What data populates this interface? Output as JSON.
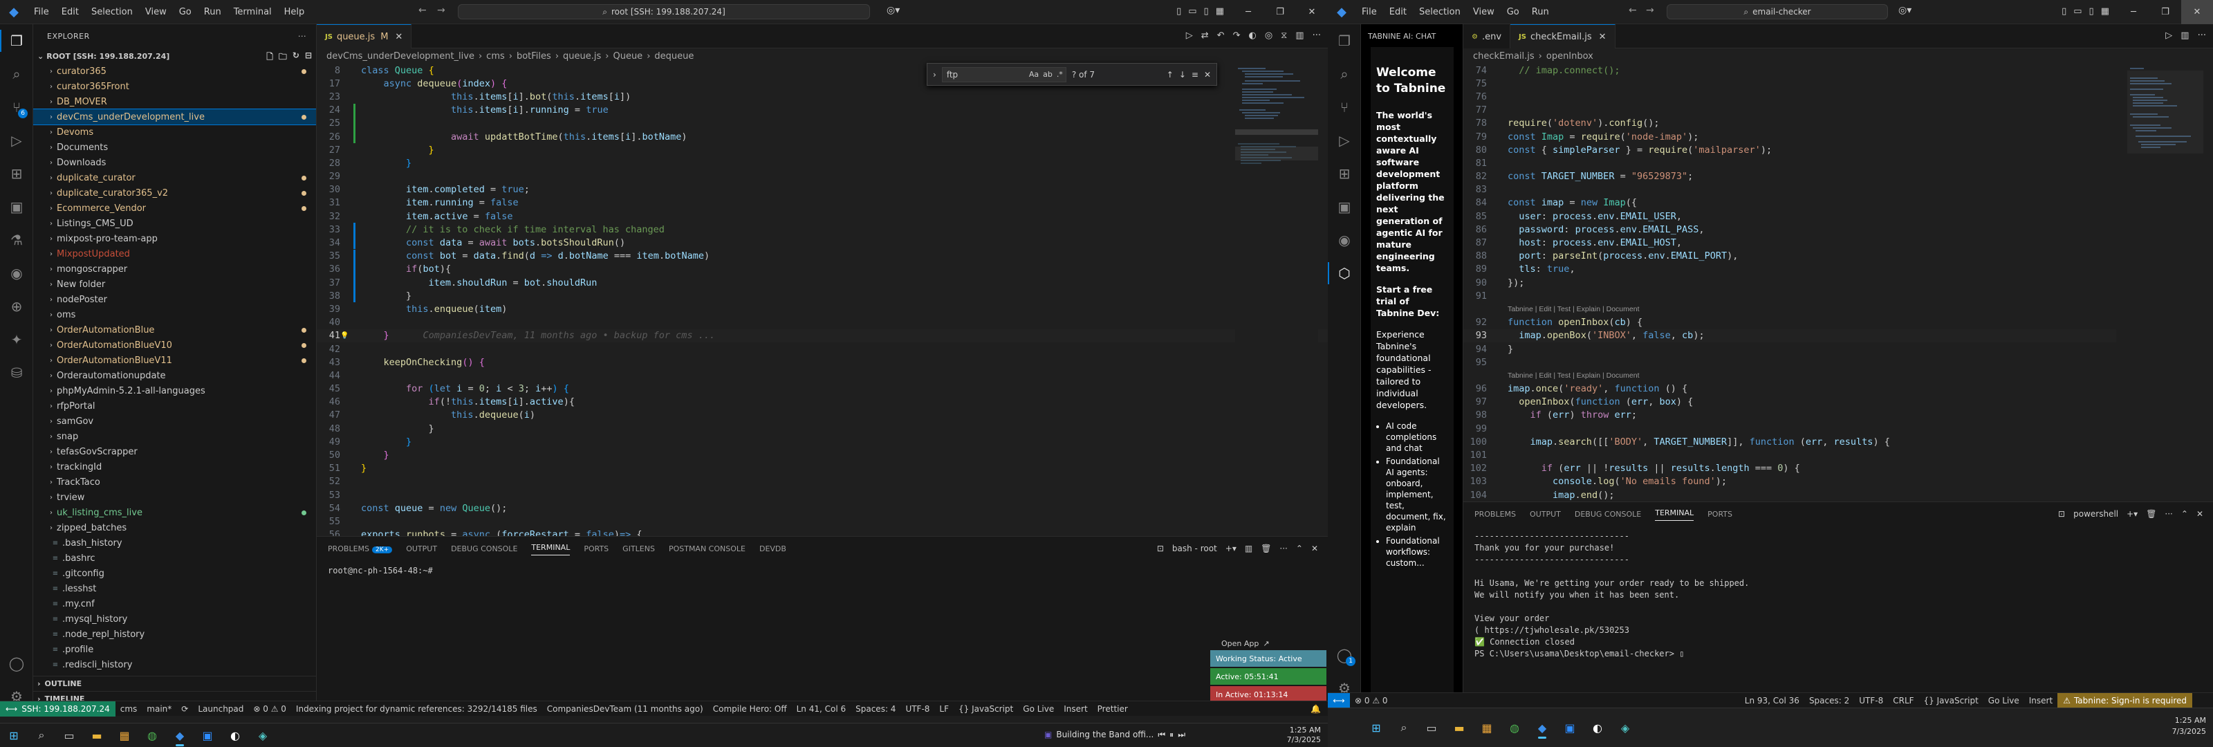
{
  "left": {
    "menu": [
      "File",
      "Edit",
      "Selection",
      "View",
      "Go",
      "Run",
      "Terminal",
      "Help"
    ],
    "command_center": "root [SSH: 199.188.207.24]",
    "explorer": {
      "title": "EXPLORER",
      "root": "ROOT [SSH: 199.188.207.24]",
      "items": [
        {
          "label": "curator365",
          "kind": "folder",
          "status": "mod",
          "dot": "#e2c08d"
        },
        {
          "label": "curator365Front",
          "kind": "folder",
          "status": "mod"
        },
        {
          "label": "DB_MOVER",
          "kind": "folder",
          "status": "mod"
        },
        {
          "label": "devCms_underDevelopment_live",
          "kind": "folder",
          "status": "mod",
          "selected": true,
          "dot": "#e2c08d"
        },
        {
          "label": "Devoms",
          "kind": "folder",
          "status": "mod"
        },
        {
          "label": "Documents",
          "kind": "folder",
          "status": "def"
        },
        {
          "label": "Downloads",
          "kind": "folder",
          "status": "def"
        },
        {
          "label": "duplicate_curator",
          "kind": "folder",
          "status": "mod",
          "dot": "#e2c08d"
        },
        {
          "label": "duplicate_curator365_v2",
          "kind": "folder",
          "status": "mod",
          "dot": "#e2c08d"
        },
        {
          "label": "Ecommerce_Vendor",
          "kind": "folder",
          "status": "mod",
          "dot": "#e2c08d"
        },
        {
          "label": "Listings_CMS_UD",
          "kind": "folder",
          "status": "def"
        },
        {
          "label": "mixpost-pro-team-app",
          "kind": "folder",
          "status": "def"
        },
        {
          "label": "MixpostUpdated",
          "kind": "folder",
          "status": "del"
        },
        {
          "label": "mongoscrapper",
          "kind": "folder",
          "status": "def"
        },
        {
          "label": "New folder",
          "kind": "folder",
          "status": "def"
        },
        {
          "label": "nodePoster",
          "kind": "folder",
          "status": "def"
        },
        {
          "label": "oms",
          "kind": "folder",
          "status": "def"
        },
        {
          "label": "OrderAutomationBlue",
          "kind": "folder",
          "status": "mod",
          "dot": "#e2c08d"
        },
        {
          "label": "OrderAutomationBlueV10",
          "kind": "folder",
          "status": "mod",
          "dot": "#e2c08d"
        },
        {
          "label": "OrderAutomationBlueV11",
          "kind": "folder",
          "status": "mod",
          "dot": "#e2c08d"
        },
        {
          "label": "Orderautomationupdate",
          "kind": "folder",
          "status": "def"
        },
        {
          "label": "phpMyAdmin-5.2.1-all-languages",
          "kind": "folder",
          "status": "def"
        },
        {
          "label": "rfpPortal",
          "kind": "folder",
          "status": "def"
        },
        {
          "label": "samGov",
          "kind": "folder",
          "status": "def"
        },
        {
          "label": "snap",
          "kind": "folder",
          "status": "def"
        },
        {
          "label": "tefasGovScrapper",
          "kind": "folder",
          "status": "def"
        },
        {
          "label": "trackingId",
          "kind": "folder",
          "status": "def"
        },
        {
          "label": "TrackTaco",
          "kind": "folder",
          "status": "def"
        },
        {
          "label": "trview",
          "kind": "folder",
          "status": "def"
        },
        {
          "label": "uk_listing_cms_live",
          "kind": "folder",
          "status": "unt",
          "dot": "#73c991"
        },
        {
          "label": "zipped_batches",
          "kind": "folder",
          "status": "def"
        },
        {
          "label": ".bash_history",
          "kind": "file",
          "status": "def"
        },
        {
          "label": ".bashrc",
          "kind": "file",
          "status": "def"
        },
        {
          "label": ".gitconfig",
          "kind": "file",
          "status": "def"
        },
        {
          "label": ".lesshst",
          "kind": "file",
          "status": "def"
        },
        {
          "label": ".my.cnf",
          "kind": "file",
          "status": "def"
        },
        {
          "label": ".mysql_history",
          "kind": "file",
          "status": "def"
        },
        {
          "label": ".node_repl_history",
          "kind": "file",
          "status": "def"
        },
        {
          "label": ".profile",
          "kind": "file",
          "status": "def"
        },
        {
          "label": ".rediscli_history",
          "kind": "file",
          "status": "def"
        }
      ],
      "outline": "OUTLINE",
      "timeline": "TIMELINE"
    },
    "tab": {
      "name": "queue.js",
      "modified": "M"
    },
    "breadcrumbs": [
      "devCms_underDevelopment_live",
      "cms",
      "botFiles",
      "queue.js",
      "Queue",
      "dequeue"
    ],
    "find": {
      "query": "ftp",
      "result": "? of 7"
    },
    "code": [
      {
        "n": "8",
        "html": "<span class='kw'>class</span> <span class='cls'>Queue</span> <span class='br1'>{</span>"
      },
      {
        "n": "17",
        "html": "    <span class='kw'>async</span> <span class='fn'>dequeue</span><span class='br2'>(</span><span class='vr'>index</span><span class='br2'>)</span> <span class='br2'>{</span>"
      },
      {
        "n": "23",
        "html": "                <span class='kw'>this</span>.<span class='vr'>items</span>[<span class='vr'>i</span>].<span class='fn'>bot</span>(<span class='kw'>this</span>.<span class='vr'>items</span>[<span class='vr'>i</span>])"
      },
      {
        "n": "24",
        "html": "                <span class='kw'>this</span>.<span class='vr'>items</span>[<span class='vr'>i</span>].<span class='vr'>running</span> = <span class='kw'>true</span>",
        "gm": "#2ea043"
      },
      {
        "n": "25",
        "html": "",
        "gm": "#2ea043"
      },
      {
        "n": "26",
        "html": "                <span class='ctl'>await</span> <span class='fn'>updattBotTime</span>(<span class='kw'>this</span>.<span class='vr'>items</span>[<span class='vr'>i</span>].<span class='vr'>botName</span>)",
        "gm": "#2ea043"
      },
      {
        "n": "27",
        "html": "            <span class='br1'>}</span>"
      },
      {
        "n": "28",
        "html": "        <span class='br3'>}</span>"
      },
      {
        "n": "29",
        "html": ""
      },
      {
        "n": "30",
        "html": "        <span class='vr'>item</span>.<span class='vr'>completed</span> = <span class='kw'>true</span>;"
      },
      {
        "n": "31",
        "html": "        <span class='vr'>item</span>.<span class='vr'>running</span> = <span class='kw'>false</span>"
      },
      {
        "n": "32",
        "html": "        <span class='vr'>item</span>.<span class='vr'>active</span> = <span class='kw'>false</span>"
      },
      {
        "n": "33",
        "html": "        <span class='cm'>// it is to check if time interval has changed</span>",
        "gm": "#0078d4"
      },
      {
        "n": "34",
        "html": "        <span class='kw'>const</span> <span class='vr'>data</span> = <span class='ctl'>await</span> <span class='vr'>bots</span>.<span class='fn'>botsShouldRun</span>()",
        "gm": "#0078d4"
      },
      {
        "n": "35",
        "html": "        <span class='kw'>const</span> <span class='vr'>bot</span> = <span class='vr'>data</span>.<span class='fn'>find</span>(<span class='vr'>d</span> <span class='kw'>=&gt;</span> <span class='vr'>d</span>.<span class='vr'>botName</span> === <span class='vr'>item</span>.<span class='vr'>botName</span>)",
        "gm": "#0078d4"
      },
      {
        "n": "36",
        "html": "        <span class='ctl'>if</span>(<span class='vr'>bot</span>){",
        "gm": "#0078d4"
      },
      {
        "n": "37",
        "html": "            <span class='vr'>item</span>.<span class='vr'>shouldRun</span> = <span class='vr'>bot</span>.<span class='vr'>shouldRun</span>",
        "gm": "#0078d4"
      },
      {
        "n": "38",
        "html": "        }",
        "gm": "#0078d4"
      },
      {
        "n": "39",
        "html": "        <span class='kw'>this</span>.<span class='fn'>enqueue</span>(<span class='vr'>item</span>)"
      },
      {
        "n": "40",
        "html": ""
      },
      {
        "n": "41",
        "html": "    <span class='br2'>}</span>      <span class='ghost'>CompaniesDevTeam, 11 months ago • backup for cms ...</span>",
        "cur": true
      },
      {
        "n": "42",
        "html": ""
      },
      {
        "n": "43",
        "html": "    <span class='fn'>keepOnChecking</span><span class='br2'>()</span> <span class='br2'>{</span>"
      },
      {
        "n": "44",
        "html": ""
      },
      {
        "n": "45",
        "html": "        <span class='ctl'>for</span> <span class='br3'>(</span><span class='kw'>let</span> <span class='vr'>i</span> = <span class='nm'>0</span>; <span class='vr'>i</span> &lt; <span class='nm'>3</span>; <span class='vr'>i</span>++<span class='br3'>)</span> <span class='br3'>{</span>"
      },
      {
        "n": "46",
        "html": "            <span class='ctl'>if</span>(!<span class='kw'>this</span>.<span class='vr'>items</span>[<span class='vr'>i</span>].<span class='vr'>active</span>){"
      },
      {
        "n": "47",
        "html": "                <span class='kw'>this</span>.<span class='fn'>dequeue</span>(<span class='vr'>i</span>)"
      },
      {
        "n": "48",
        "html": "            }"
      },
      {
        "n": "49",
        "html": "        <span class='br3'>}</span>"
      },
      {
        "n": "50",
        "html": "    <span class='br2'>}</span>"
      },
      {
        "n": "51",
        "html": "<span class='br1'>}</span>"
      },
      {
        "n": "52",
        "html": ""
      },
      {
        "n": "53",
        "html": ""
      },
      {
        "n": "54",
        "html": "<span class='kw'>const</span> <span class='vr'>queue</span> = <span class='kw'>new</span> <span class='cls'>Queue</span>();"
      },
      {
        "n": "55",
        "html": ""
      },
      {
        "n": "56",
        "html": "<span class='vr'>exports</span>.<span class='fn'>runbots</span> = <span class='kw'>async</span> (<span class='vr'>forceRestart</span> = <span class='kw'>false</span>)<span class='kw'>=&gt;</span> {"
      }
    ],
    "panel_tabs": [
      "PROBLEMS",
      "OUTPUT",
      "DEBUG CONSOLE",
      "TERMINAL",
      "PORTS",
      "GITLENS",
      "POSTMAN CONSOLE",
      "DEVDB"
    ],
    "problems_count": "2K+",
    "terminal_label": "bash - root",
    "terminal_prompt": "root@nc-ph-1564-48:~#",
    "notifications": {
      "open_app": "Open App",
      "working": "Working Status: Active",
      "active": "Active: 05:51:41",
      "inactive": "In Active: 01:13:14"
    },
    "status": {
      "remote": "SSH: 199.188.207.24",
      "items": [
        "cms",
        "main*",
        "⟳",
        "Launchpad",
        "⊗ 0 ⚠ 0",
        "Indexing project for dynamic references: 3292/14185 files",
        "CompaniesDevTeam (11 months ago)",
        "Compile Hero: Off",
        "Ln 41, Col 6",
        "Spaces: 4",
        "UTF-8",
        "LF",
        "{} JavaScript",
        "Go Live",
        "Insert",
        "Prettier"
      ]
    },
    "taskbar": {
      "media": "Building the Band offi...",
      "time": "1:25 AM",
      "date": "7/3/2025"
    }
  },
  "right": {
    "menu": [
      "File",
      "Edit",
      "Selection",
      "View",
      "Go",
      "Run"
    ],
    "command_center": "email-checker",
    "tabnine": {
      "header": "TABNINE AI: CHAT",
      "title": "Welcome to Tabnine",
      "p1": "The world's most contextually aware AI software development platform delivering the next generation of agentic AI for mature engineering teams.",
      "p2": "Start a free trial of Tabnine Dev:",
      "p3": "Experience Tabnine's foundational capabilities - tailored to individual developers.",
      "bullets": [
        "AI code completions and chat",
        "Foundational AI agents: onboard, implement, test, document, fix, explain",
        "Foundational workflows: custom..."
      ]
    },
    "tabs": [
      {
        "name": ".env"
      },
      {
        "name": "checkEmail.js",
        "active": true
      }
    ],
    "breadcrumbs": [
      "checkEmail.js",
      "openInbox"
    ],
    "codelens": "Tabnine | Edit | Test | Explain | Document",
    "code": [
      {
        "n": "74",
        "html": "  <span class='cm'>// imap.connect();</span>"
      },
      {
        "n": "75",
        "html": ""
      },
      {
        "n": "76",
        "html": ""
      },
      {
        "n": "77",
        "html": ""
      },
      {
        "n": "78",
        "html": "<span class='fn'>require</span>(<span class='st'>'dotenv'</span>).<span class='fn'>config</span>();"
      },
      {
        "n": "79",
        "html": "<span class='kw'>const</span> <span class='cls'>Imap</span> = <span class='fn'>require</span>(<span class='st'>'node-imap'</span>);"
      },
      {
        "n": "80",
        "html": "<span class='kw'>const</span> { <span class='vr'>simpleParser</span> } = <span class='fn'>require</span>(<span class='st'>'mailparser'</span>);"
      },
      {
        "n": "81",
        "html": ""
      },
      {
        "n": "82",
        "html": "<span class='kw'>const</span> <span class='vr'>TARGET_NUMBER</span> = <span class='st'>\"96529873\"</span>;"
      },
      {
        "n": "83",
        "html": ""
      },
      {
        "n": "84",
        "html": "<span class='kw'>const</span> <span class='vr'>imap</span> = <span class='kw'>new</span> <span class='cls'>Imap</span>({"
      },
      {
        "n": "85",
        "html": "  <span class='vr'>user</span>: <span class='vr'>process</span>.<span class='vr'>env</span>.<span class='vr'>EMAIL_USER</span>,"
      },
      {
        "n": "86",
        "html": "  <span class='vr'>password</span>: <span class='vr'>process</span>.<span class='vr'>env</span>.<span class='vr'>EMAIL_PASS</span>,"
      },
      {
        "n": "87",
        "html": "  <span class='vr'>host</span>: <span class='vr'>process</span>.<span class='vr'>env</span>.<span class='vr'>EMAIL_HOST</span>,"
      },
      {
        "n": "88",
        "html": "  <span class='vr'>port</span>: <span class='fn'>parseInt</span>(<span class='vr'>process</span>.<span class='vr'>env</span>.<span class='vr'>EMAIL_PORT</span>),"
      },
      {
        "n": "89",
        "html": "  <span class='vr'>tls</span>: <span class='kw'>true</span>,"
      },
      {
        "n": "90",
        "html": "});"
      },
      {
        "n": "91",
        "html": ""
      },
      {
        "n": "",
        "lens": true
      },
      {
        "n": "92",
        "html": "<span class='kw'>function</span> <span class='fn'>openInbox</span>(<span class='vr'>cb</span>) {"
      },
      {
        "n": "93",
        "html": "  <span class='vr'>imap</span>.<span class='fn'>openBox</span>(<span class='st'>'INBOX'</span>, <span class='kw'>false</span>, <span class='vr'>cb</span>);",
        "cur": true
      },
      {
        "n": "94",
        "html": "}"
      },
      {
        "n": "95",
        "html": ""
      },
      {
        "n": "",
        "lens": true
      },
      {
        "n": "96",
        "html": "<span class='vr'>imap</span>.<span class='fn'>once</span>(<span class='st'>'ready'</span>, <span class='kw'>function</span> () {"
      },
      {
        "n": "97",
        "html": "  <span class='fn'>openInbox</span>(<span class='kw'>function</span> (<span class='vr'>err</span>, <span class='vr'>box</span>) {"
      },
      {
        "n": "98",
        "html": "    <span class='ctl'>if</span> (<span class='vr'>err</span>) <span class='ctl'>throw</span> <span class='vr'>err</span>;"
      },
      {
        "n": "99",
        "html": ""
      },
      {
        "n": "100",
        "html": "    <span class='vr'>imap</span>.<span class='fn'>search</span>([[<span class='st'>'BODY'</span>, <span class='vr'>TARGET_NUMBER</span>]], <span class='kw'>function</span> (<span class='vr'>err</span>, <span class='vr'>results</span>) {"
      },
      {
        "n": "101",
        "html": ""
      },
      {
        "n": "102",
        "html": "      <span class='ctl'>if</span> (<span class='vr'>err</span> || !<span class='vr'>results</span> || <span class='vr'>results</span>.<span class='vr'>length</span> === <span class='nm'>0</span>) {"
      },
      {
        "n": "103",
        "html": "        <span class='vr'>console</span>.<span class='fn'>log</span>(<span class='st'>'No emails found'</span>);"
      },
      {
        "n": "104",
        "html": "        <span class='vr'>imap</span>.<span class='fn'>end</span>();"
      }
    ],
    "panel_tabs": [
      "PROBLEMS",
      "OUTPUT",
      "DEBUG CONSOLE",
      "TERMINAL",
      "PORTS"
    ],
    "terminal_label": "powershell",
    "terminal_lines": [
      "-------------------------------",
      "Thank you for your purchase!",
      "-------------------------------",
      "",
      "Hi Usama, We're getting your order ready to be shipped.",
      "We will notify you when it has been sent.",
      "",
      "View your order",
      "( https://tjwholesale.pk/530253",
      "✅ Connection closed",
      "PS C:\\Users\\usama\\Desktop\\email-checker> ▯"
    ],
    "status": {
      "items": [
        "⊗ 0 ⚠ 0",
        "Ln 93, Col 36",
        "Spaces: 2",
        "UTF-8",
        "CRLF",
        "{} JavaScript",
        "Go Live",
        "Insert"
      ],
      "tabnine": "Tabnine: Sign-in is required"
    },
    "taskbar": {
      "time": "1:25 AM",
      "date": "7/3/2025"
    }
  }
}
